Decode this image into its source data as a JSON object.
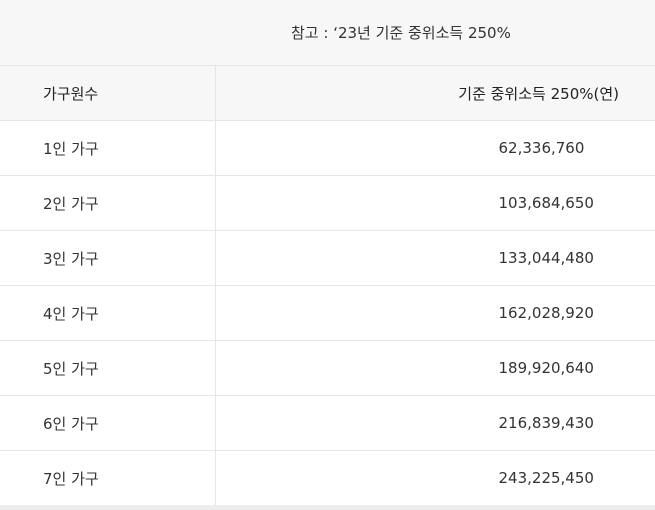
{
  "caption": "참고 : ‘23년 기준 중위소득 250%",
  "table": {
    "headers": [
      "가구원수",
      "기준 중위소득 250%(연)"
    ],
    "rows": [
      {
        "label": "1인 가구",
        "value": "62,336,760"
      },
      {
        "label": "2인 가구",
        "value": "103,684,650"
      },
      {
        "label": "3인 가구",
        "value": "133,044,480"
      },
      {
        "label": "4인 가구",
        "value": "162,028,920"
      },
      {
        "label": "5인 가구",
        "value": "189,920,640"
      },
      {
        "label": "6인 가구",
        "value": "216,839,430"
      },
      {
        "label": "7인 가구",
        "value": "243,225,450"
      }
    ]
  }
}
